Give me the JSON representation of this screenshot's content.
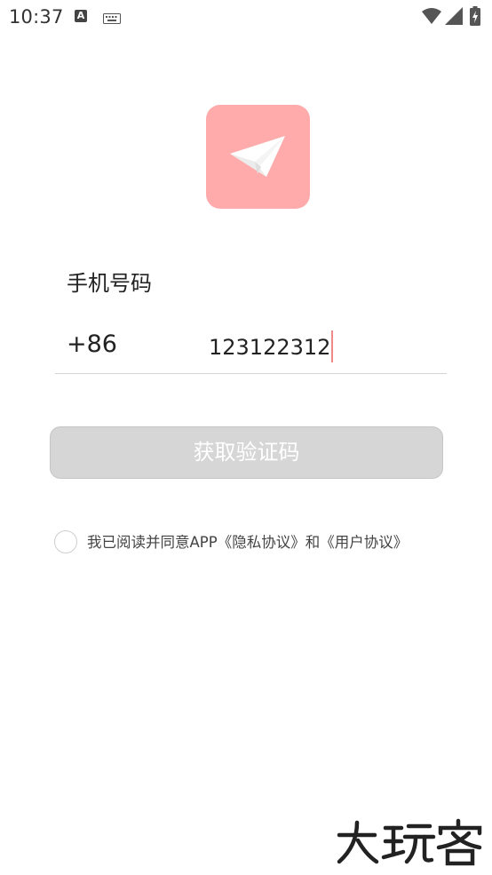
{
  "status_bar": {
    "time": "10:37",
    "icons": [
      "text-a-icon",
      "keyboard-icon",
      "wifi-icon",
      "signal-icon",
      "battery-charging-icon"
    ]
  },
  "logo": {
    "icon": "paper-plane-icon",
    "color": "#ffabab"
  },
  "form": {
    "label": "手机号码",
    "country_code": "+86",
    "phone_value": "123122312"
  },
  "button": {
    "label": "获取验证码",
    "bg": "#d6d6d6"
  },
  "agreement": {
    "prefix": "我已阅读并同意APP",
    "privacy": "《隐私协议》",
    "and": "和",
    "user": "《用户协议》"
  },
  "watermark": {
    "text": "大玩客"
  }
}
